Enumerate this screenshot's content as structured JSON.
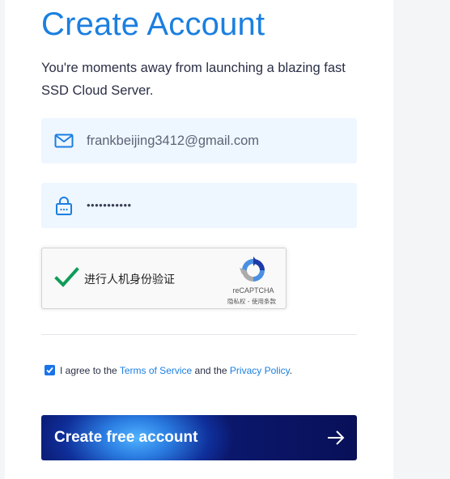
{
  "header": {
    "title": "Create Account",
    "subtitle": "You're moments away from launching a blazing fast SSD Cloud Server."
  },
  "form": {
    "email": {
      "icon": "envelope-icon",
      "value": "frankbeijing3412@gmail.com"
    },
    "password": {
      "icon": "lock-icon",
      "value": "•••••••••••"
    }
  },
  "recaptcha": {
    "label": "进行人机身份验证",
    "brand": "reCAPTCHA",
    "links": "隐私权 - 使用条款",
    "checked": true
  },
  "agreement": {
    "checked": true,
    "prefix": "I agree to the ",
    "terms_link": "Terms of Service",
    "middle": " and the ",
    "privacy_link": "Privacy Policy",
    "suffix": "."
  },
  "submit": {
    "label": "Create free account",
    "icon": "arrow-right-icon"
  },
  "colors": {
    "accent": "#1b7fe0",
    "field_bg": "#eef6ff",
    "button_dark": "#0c1a72",
    "check_green": "#0f9d58"
  }
}
